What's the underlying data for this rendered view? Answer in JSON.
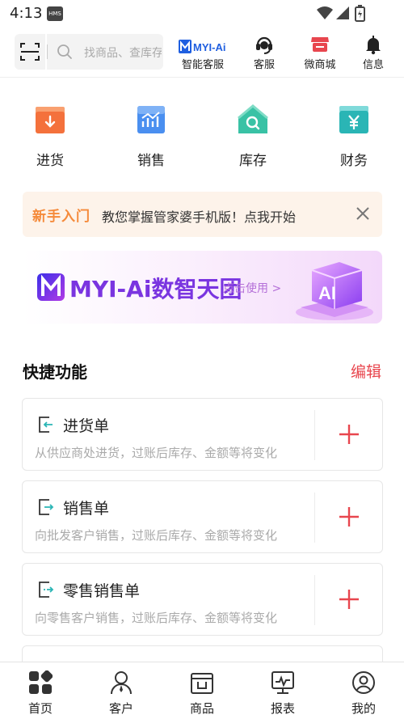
{
  "status_bar": {
    "time": "4:13",
    "badge": "HMS"
  },
  "header": {
    "search_placeholder": "找商品、查库存",
    "items": [
      {
        "label": "智能客服",
        "icon": "myi-ai-logo"
      },
      {
        "label": "客服",
        "icon": "headset-icon"
      },
      {
        "label": "微商城",
        "icon": "shop-icon"
      },
      {
        "label": "信息",
        "icon": "bell-icon"
      }
    ],
    "ai_logo_text": "MYI-Ai"
  },
  "quick_nav": [
    {
      "label": "进货",
      "icon": "purchase-icon",
      "color": "#f4713c"
    },
    {
      "label": "销售",
      "icon": "sales-chart-icon",
      "color": "#4a8ff0"
    },
    {
      "label": "库存",
      "icon": "inventory-house-icon",
      "color": "#39c2a5"
    },
    {
      "label": "财务",
      "icon": "finance-yen-icon",
      "color": "#2ab5b5"
    }
  ],
  "newbie_banner": {
    "tag": "新手入门",
    "text": "教您掌握管家婆手机版！点我开始"
  },
  "ai_banner": {
    "title": "MYI-Ai数智天团",
    "cta": "点击使用 >",
    "graphic_text": "AI"
  },
  "shortcuts": {
    "title": "快捷功能",
    "edit_label": "编辑",
    "items": [
      {
        "title": "进货单",
        "desc": "从供应商处进货，过账后库存、金额等将变化"
      },
      {
        "title": "销售单",
        "desc": "向批发客户销售，过账后库存、金额等将变化"
      },
      {
        "title": "零售销售单",
        "desc": "向零售客户销售，过账后库存、金额等将变化"
      }
    ]
  },
  "tabbar": [
    {
      "label": "首页",
      "icon": "home-grid-icon",
      "active": true
    },
    {
      "label": "客户",
      "icon": "customer-icon"
    },
    {
      "label": "商品",
      "icon": "goods-icon"
    },
    {
      "label": "报表",
      "icon": "report-icon"
    },
    {
      "label": "我的",
      "icon": "profile-icon"
    }
  ],
  "colors": {
    "accent": "#e8464e",
    "ai_purple": "#7a35e0",
    "newbie_orange": "#f58a3a"
  }
}
